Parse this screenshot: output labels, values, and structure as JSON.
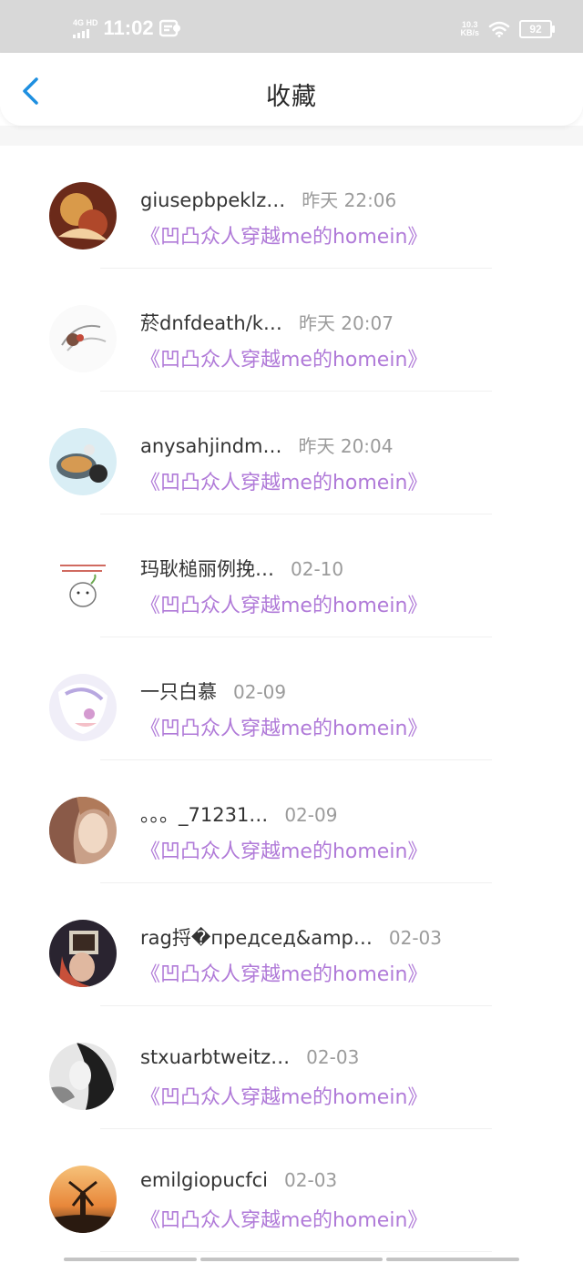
{
  "status_bar": {
    "network": "4G HD",
    "time": "11:02",
    "speed_value": "10.3",
    "speed_unit": "KB/s",
    "battery": "92"
  },
  "header": {
    "title": "收藏",
    "back_icon": "chevron-left-icon"
  },
  "items": [
    {
      "name": "giusepbpeklz…",
      "time": "昨天 22:06",
      "title": "《凹凸众人穿越me的homein》"
    },
    {
      "name": "菸dnfdeath/k…",
      "time": "昨天 20:07",
      "title": "《凹凸众人穿越me的homein》"
    },
    {
      "name": "anysahjindm…",
      "time": "昨天 20:04",
      "title": "《凹凸众人穿越me的homein》"
    },
    {
      "name": "玛耿槌丽例挽…",
      "time": "02-10",
      "title": "《凹凸众人穿越me的homein》"
    },
    {
      "name": "一只白慕",
      "time": "02-09",
      "title": "《凹凸众人穿越me的homein》"
    },
    {
      "name": "。。。_71231…",
      "time": "02-09",
      "title": "《凹凸众人穿越me的homein》"
    },
    {
      "name": "rag捋�председ&amp…",
      "time": "02-03",
      "title": "《凹凸众人穿越me的homein》"
    },
    {
      "name": "stxuarbtweitz…",
      "time": "02-03",
      "title": "《凹凸众人穿越me的homein》"
    },
    {
      "name": "emilgiopucfci",
      "time": "02-03",
      "title": "《凹凸众人穿越me的homein》"
    }
  ],
  "colors": {
    "accent_title": "#b07ad8",
    "back_icon": "#1e8fe0",
    "status_bg": "#d8d8d8"
  }
}
